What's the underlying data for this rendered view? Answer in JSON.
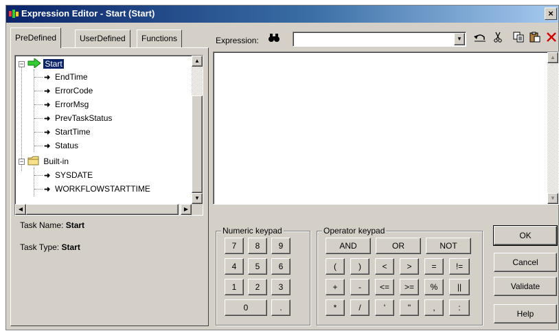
{
  "window": {
    "title": "Expression Editor - Start (Start)",
    "close_glyph": "×"
  },
  "tabs": [
    "PreDefined",
    "UserDefined",
    "Functions"
  ],
  "tree": {
    "nodes": [
      {
        "label": "Start",
        "icon": "arrow-right-green-icon",
        "selected": true
      },
      {
        "label": "EndTime"
      },
      {
        "label": "ErrorCode"
      },
      {
        "label": "ErrorMsg"
      },
      {
        "label": "PrevTaskStatus"
      },
      {
        "label": "StartTime"
      },
      {
        "label": "Status"
      },
      {
        "label": "Built-in",
        "icon": "folder-icon"
      },
      {
        "label": "SYSDATE"
      },
      {
        "label": "WORKFLOWSTARTTIME"
      }
    ],
    "collapse_glyph": "−",
    "leaf_glyph": "➜"
  },
  "task_info": {
    "name_label": "Task Name:",
    "name_value": "Start",
    "type_label": "Task Type:",
    "type_value": "Start"
  },
  "expression": {
    "label": "Expression:",
    "value": ""
  },
  "toolbar": [
    {
      "name": "find-icon",
      "glyph": "🔍"
    },
    {
      "name": "undo-icon",
      "glyph": "↶"
    },
    {
      "name": "cut-icon",
      "glyph": "✂"
    },
    {
      "name": "copy-icon",
      "glyph": "⎘"
    },
    {
      "name": "paste-icon",
      "glyph": "📋"
    },
    {
      "name": "delete-icon",
      "glyph": "✕"
    }
  ],
  "numeric_keypad": {
    "title": "Numeric keypad",
    "keys": [
      "7",
      "8",
      "9",
      "4",
      "5",
      "6",
      "1",
      "2",
      "3",
      "0",
      "."
    ]
  },
  "operator_keypad": {
    "title": "Operator keypad",
    "row1": [
      "AND",
      "OR",
      "NOT"
    ],
    "row2": [
      "(",
      ")",
      "<",
      ">",
      "=",
      "!="
    ],
    "row3": [
      "+",
      "-",
      "<=",
      ">=",
      "%",
      "||"
    ],
    "row4": [
      "*",
      "/",
      "'",
      "\"",
      ",",
      ":"
    ]
  },
  "buttons": {
    "ok": "OK",
    "cancel": "Cancel",
    "validate": "Validate",
    "help": "Help"
  },
  "colors": {
    "face": "#d4d0c8",
    "title_start": "#0a246a",
    "title_end": "#a6caf0",
    "selection": "#0a246a",
    "delete_red": "#d40000"
  }
}
